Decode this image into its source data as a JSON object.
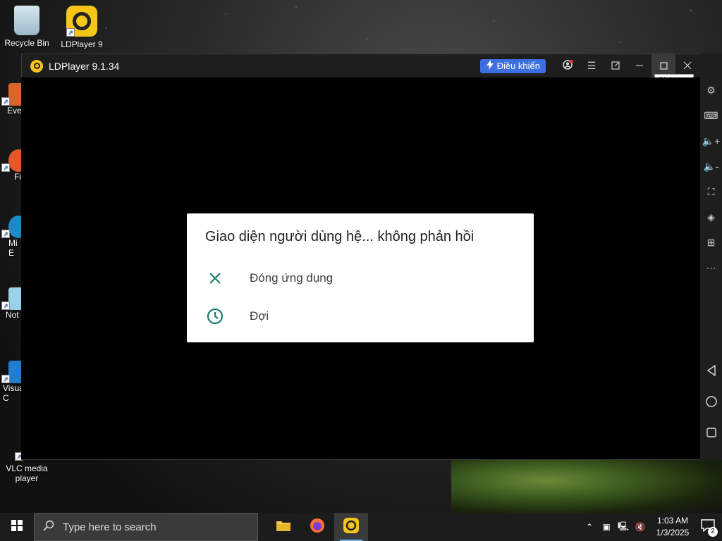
{
  "desktop": {
    "icons": [
      {
        "label": "Recycle Bin"
      },
      {
        "label": "LDPlayer 9"
      },
      {
        "label": "Eve"
      },
      {
        "label": "Fi"
      },
      {
        "label": "Mi\nE"
      },
      {
        "label": "Not"
      },
      {
        "label": "Visua\nC"
      },
      {
        "label": "VLC media player"
      }
    ]
  },
  "ldplayer": {
    "title": "LDPlayer 9.1.34",
    "control_button": "Điều khiển",
    "tooltip": "Phóng to",
    "accent": "#3d6fe0"
  },
  "dialog": {
    "title": "Giao diện người dùng hệ... không phản hồi",
    "options": [
      {
        "label": "Đóng ứng dụng",
        "icon": "close-icon"
      },
      {
        "label": "Đợi",
        "icon": "clock-icon"
      }
    ],
    "icon_color": "#1a7f6a"
  },
  "taskbar": {
    "search_placeholder": "Type here to search",
    "time": "1:03 AM",
    "date": "1/3/2025",
    "notification_count": "2"
  }
}
